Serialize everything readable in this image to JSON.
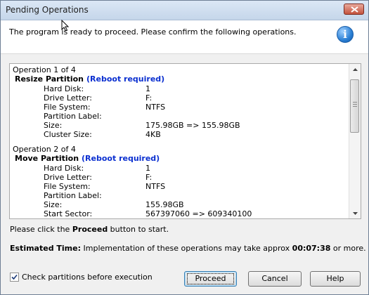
{
  "window": {
    "title": "Pending Operations"
  },
  "header": {
    "message": "The program is ready to proceed. Please confirm the following operations."
  },
  "operations": [
    {
      "counter": "Operation 1 of 4",
      "title": "Resize Partition",
      "note": "(Reboot required)",
      "props": [
        {
          "key": "Hard Disk:",
          "value": "1"
        },
        {
          "key": "Drive Letter:",
          "value": "F:"
        },
        {
          "key": "File System:",
          "value": "NTFS"
        },
        {
          "key": "Partition Label:",
          "value": ""
        },
        {
          "key": "Size:",
          "value": "175.98GB => 155.98GB"
        },
        {
          "key": "Cluster Size:",
          "value": "4KB"
        }
      ]
    },
    {
      "counter": "Operation 2 of 4",
      "title": "Move Partition",
      "note": "(Reboot required)",
      "props": [
        {
          "key": "Hard Disk:",
          "value": "1"
        },
        {
          "key": "Drive Letter:",
          "value": "F:"
        },
        {
          "key": "File System:",
          "value": "NTFS"
        },
        {
          "key": "Partition Label:",
          "value": ""
        },
        {
          "key": "Size:",
          "value": "155.98GB"
        },
        {
          "key": "Start Sector:",
          "value": "567397060 => 609340100"
        }
      ]
    }
  ],
  "instruction": {
    "prefix": "Please click the ",
    "keyword": "Proceed",
    "suffix": " button to start."
  },
  "estimate": {
    "label": "Estimated Time:",
    "text": " Implementation of these operations may take approx ",
    "time": "00:07:38",
    "suffix": " or more."
  },
  "check_partitions": {
    "label": "Check partitions before execution",
    "checked": true
  },
  "buttons": {
    "proceed": "Proceed",
    "cancel": "Cancel",
    "help": "Help"
  },
  "colors": {
    "reboot_note": "#0a2fd0",
    "info_icon": "#2a7fd4",
    "close_button": "#c3523d"
  }
}
